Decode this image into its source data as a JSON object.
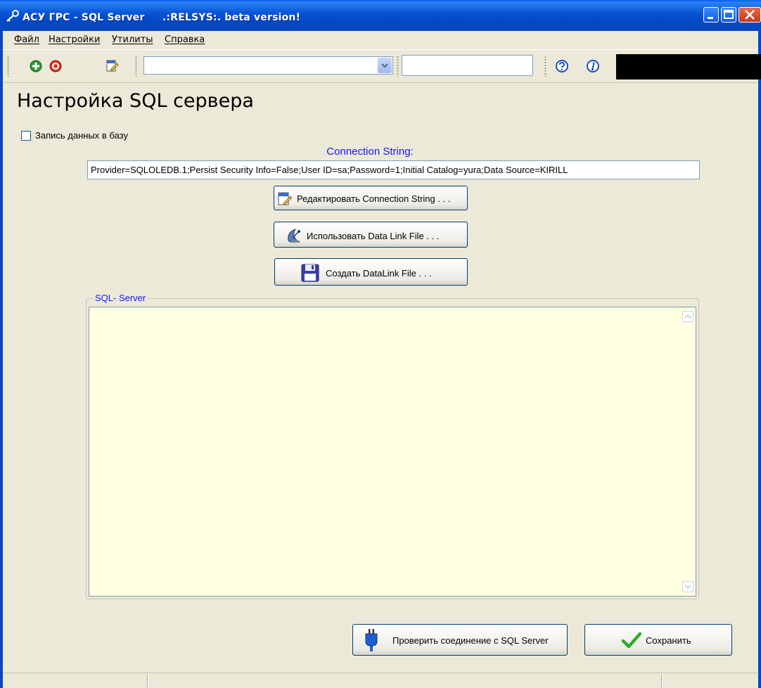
{
  "window": {
    "title": "АСУ ГРС - SQL Server     .:RELSYS:. beta version!"
  },
  "menu": [
    {
      "label": "Файл"
    },
    {
      "label": "Настройки"
    },
    {
      "label": "Утилиты"
    },
    {
      "label": "Справка"
    }
  ],
  "toolbar": {
    "combo_value": "",
    "search_value": ""
  },
  "page": {
    "title": "Настройка SQL сервера",
    "checkbox_label": "Запись данных в базу",
    "checkbox_checked": false,
    "connection_label": "Connection String:",
    "connection_string": "Provider=SQLOLEDB.1;Persist Security Info=False;User ID=sa;Password=1;Initial Catalog=yura;Data Source=KIRILL",
    "edit_button": "Редактировать Connection String . . .",
    "datalink_button": "Использовать Data Link File . . .",
    "create_button": "Создать DataLink File . . .",
    "group_title": "SQL- Server",
    "memo_text": "",
    "check_button": "Проверить соединение с SQL Server",
    "save_button": "Сохранить"
  },
  "colors": {
    "accent_label": "#1515ff",
    "memo_background": "#ffffe1",
    "titlebar": "#0147c7"
  },
  "icons": [
    "key-icon",
    "add-icon",
    "stop-icon",
    "edit-document-icon",
    "help-icon",
    "info-icon",
    "satellite-dish-icon",
    "floppy-disk-icon",
    "plug-icon",
    "checkmark-icon"
  ]
}
